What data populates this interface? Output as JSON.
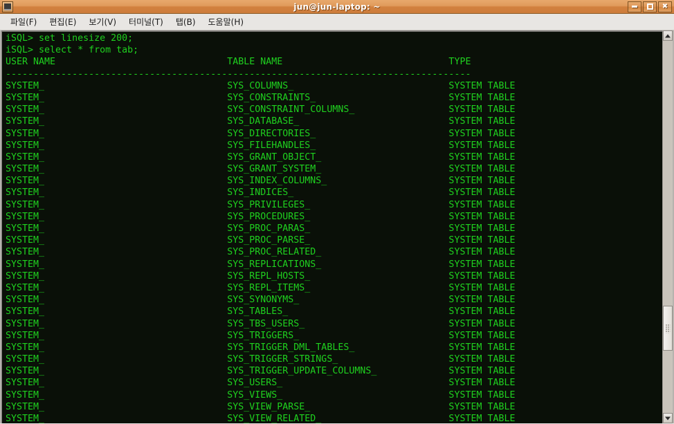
{
  "window": {
    "title": "jun@jun-laptop: ~",
    "icon": "terminal-icon",
    "controls": [
      {
        "name": "minimize",
        "glyph": "_"
      },
      {
        "name": "maximize",
        "glyph": "□"
      },
      {
        "name": "close",
        "glyph": "✖"
      }
    ]
  },
  "menubar": {
    "items": [
      {
        "label": "파일(F)",
        "mnemonic": "F"
      },
      {
        "label": "편집(E)",
        "mnemonic": "E"
      },
      {
        "label": "보기(V)",
        "mnemonic": "V"
      },
      {
        "label": "터미널(T)",
        "mnemonic": "T"
      },
      {
        "label": "탭(B)",
        "mnemonic": "B"
      },
      {
        "label": "도움말(H)",
        "mnemonic": "H"
      }
    ]
  },
  "terminal": {
    "foreground_color": "#1fd11f",
    "background_color": "#0a1008",
    "prompt": "iSQL>",
    "commands": [
      "iSQL> set linesize 200;",
      "iSQL> select * from tab;"
    ],
    "header_line": "USER NAME                           TABLE NAME                              TYPE",
    "separator_line": "-----------------------------------------------------------------------------------",
    "columns": [
      "USER NAME",
      "TABLE NAME",
      "TYPE"
    ],
    "rows": [
      {
        "user_name": "SYSTEM_",
        "table_name": "SYS_COLUMNS_",
        "type": "SYSTEM TABLE"
      },
      {
        "user_name": "SYSTEM_",
        "table_name": "SYS_CONSTRAINTS_",
        "type": "SYSTEM TABLE"
      },
      {
        "user_name": "SYSTEM_",
        "table_name": "SYS_CONSTRAINT_COLUMNS_",
        "type": "SYSTEM TABLE"
      },
      {
        "user_name": "SYSTEM_",
        "table_name": "SYS_DATABASE_",
        "type": "SYSTEM TABLE"
      },
      {
        "user_name": "SYSTEM_",
        "table_name": "SYS_DIRECTORIES_",
        "type": "SYSTEM TABLE"
      },
      {
        "user_name": "SYSTEM_",
        "table_name": "SYS_FILEHANDLES_",
        "type": "SYSTEM TABLE"
      },
      {
        "user_name": "SYSTEM_",
        "table_name": "SYS_GRANT_OBJECT_",
        "type": "SYSTEM TABLE"
      },
      {
        "user_name": "SYSTEM_",
        "table_name": "SYS_GRANT_SYSTEM_",
        "type": "SYSTEM TABLE"
      },
      {
        "user_name": "SYSTEM_",
        "table_name": "SYS_INDEX_COLUMNS_",
        "type": "SYSTEM TABLE"
      },
      {
        "user_name": "SYSTEM_",
        "table_name": "SYS_INDICES_",
        "type": "SYSTEM TABLE"
      },
      {
        "user_name": "SYSTEM_",
        "table_name": "SYS_PRIVILEGES_",
        "type": "SYSTEM TABLE"
      },
      {
        "user_name": "SYSTEM_",
        "table_name": "SYS_PROCEDURES_",
        "type": "SYSTEM TABLE"
      },
      {
        "user_name": "SYSTEM_",
        "table_name": "SYS_PROC_PARAS_",
        "type": "SYSTEM TABLE"
      },
      {
        "user_name": "SYSTEM_",
        "table_name": "SYS_PROC_PARSE_",
        "type": "SYSTEM TABLE"
      },
      {
        "user_name": "SYSTEM_",
        "table_name": "SYS_PROC_RELATED_",
        "type": "SYSTEM TABLE"
      },
      {
        "user_name": "SYSTEM_",
        "table_name": "SYS_REPLICATIONS_",
        "type": "SYSTEM TABLE"
      },
      {
        "user_name": "SYSTEM_",
        "table_name": "SYS_REPL_HOSTS_",
        "type": "SYSTEM TABLE"
      },
      {
        "user_name": "SYSTEM_",
        "table_name": "SYS_REPL_ITEMS_",
        "type": "SYSTEM TABLE"
      },
      {
        "user_name": "SYSTEM_",
        "table_name": "SYS_SYNONYMS_",
        "type": "SYSTEM TABLE"
      },
      {
        "user_name": "SYSTEM_",
        "table_name": "SYS_TABLES_",
        "type": "SYSTEM TABLE"
      },
      {
        "user_name": "SYSTEM_",
        "table_name": "SYS_TBS_USERS_",
        "type": "SYSTEM TABLE"
      },
      {
        "user_name": "SYSTEM_",
        "table_name": "SYS_TRIGGERS_",
        "type": "SYSTEM TABLE"
      },
      {
        "user_name": "SYSTEM_",
        "table_name": "SYS_TRIGGER_DML_TABLES_",
        "type": "SYSTEM TABLE"
      },
      {
        "user_name": "SYSTEM_",
        "table_name": "SYS_TRIGGER_STRINGS_",
        "type": "SYSTEM TABLE"
      },
      {
        "user_name": "SYSTEM_",
        "table_name": "SYS_TRIGGER_UPDATE_COLUMNS_",
        "type": "SYSTEM TABLE"
      },
      {
        "user_name": "SYSTEM_",
        "table_name": "SYS_USERS_",
        "type": "SYSTEM TABLE"
      },
      {
        "user_name": "SYSTEM_",
        "table_name": "SYS_VIEWS_",
        "type": "SYSTEM TABLE"
      },
      {
        "user_name": "SYSTEM_",
        "table_name": "SYS_VIEW_PARSE_",
        "type": "SYSTEM TABLE"
      },
      {
        "user_name": "SYSTEM_",
        "table_name": "SYS_VIEW_RELATED_",
        "type": "SYSTEM TABLE"
      }
    ],
    "layout": {
      "col_user_chars": 0,
      "col_table_chars": 40,
      "col_type_chars": 80,
      "separator_chars": 84
    }
  },
  "scrollbar": {
    "up_arrow": "scroll-up-arrow",
    "down_arrow": "scroll-down-arrow",
    "thumb_position_percent": 81,
    "thumb_size_percent": 12
  }
}
